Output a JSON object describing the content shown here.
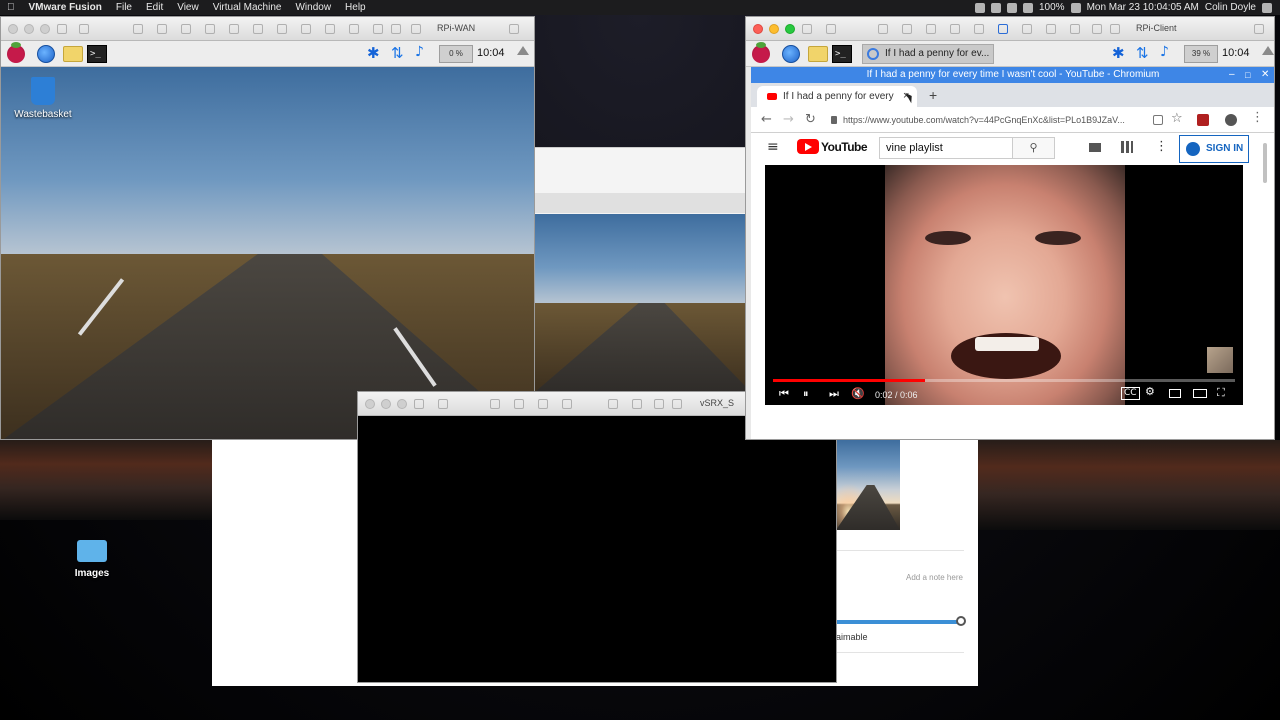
{
  "menubar": {
    "app": "VMware Fusion",
    "items": [
      "File",
      "Edit",
      "View",
      "Virtual Machine",
      "Window",
      "Help"
    ],
    "battery": "100%",
    "datetime": "Mon Mar 23  10:04:05 AM",
    "user": "Colin Doyle"
  },
  "rpi_wan": {
    "title": "RPi-WAN",
    "cpu": "0 %",
    "clock": "10:04",
    "desktop_icon": "Wastebasket"
  },
  "rpi_client": {
    "title": "RPi-Client",
    "taskbar_item": "If I had a penny for ev...",
    "cpu": "39 %",
    "clock": "10:04"
  },
  "vsrx": {
    "title": "vSRX_S"
  },
  "mac_desktop": {
    "images_folder": "Images"
  },
  "background_window": {
    "note_placeholder": "Add a note here",
    "label": "aimable"
  },
  "chromium": {
    "window_title": "If I had a penny for every time I wasn't cool - YouTube - Chromium",
    "tab_title": "If I had a penny for every",
    "tab_close": "×",
    "new_tab": "+",
    "url": "https://www.youtube.com/watch?v=44PcGnqEnXc&list=PLo1B9JZaV..."
  },
  "youtube": {
    "logo": "YouTube",
    "search_value": "vine playlist",
    "sign_in": "SIGN IN",
    "video_time": "0:02 / 0:06",
    "progress": 0.33
  },
  "colors": {
    "chrome_title": "#3e86e6",
    "yt_red": "#ff0000",
    "signin_blue": "#1565c0"
  }
}
